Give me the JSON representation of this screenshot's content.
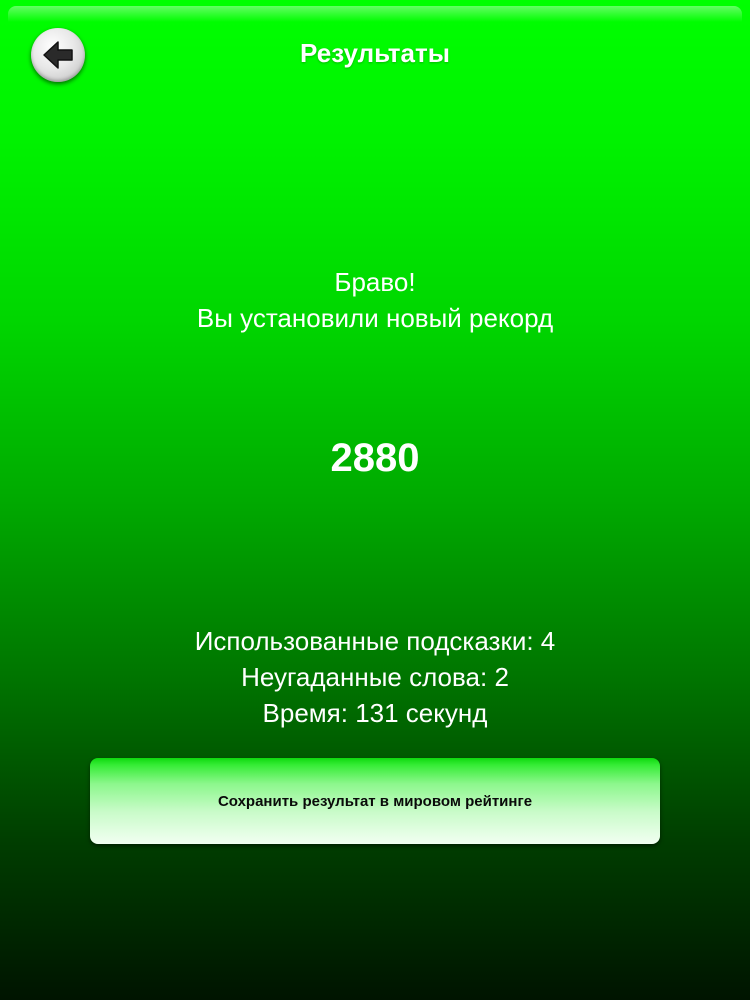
{
  "header": {
    "title": "Результаты",
    "back_icon": "arrow-left-icon"
  },
  "message": {
    "line1": "Браво!",
    "line2": "Вы установили новый рекорд"
  },
  "score": "2880",
  "stats": {
    "hints_used": "Использованные подсказки: 4",
    "unguessed_words": "Неугаданные слова: 2",
    "time": "Время: 131 секунд"
  },
  "actions": {
    "save_label": "Сохранить результат в мировом рейтинге"
  },
  "colors": {
    "background_top": "#00ff00",
    "background_bottom": "#001400",
    "text": "#ffffff",
    "button_text": "#0a0a0a"
  }
}
